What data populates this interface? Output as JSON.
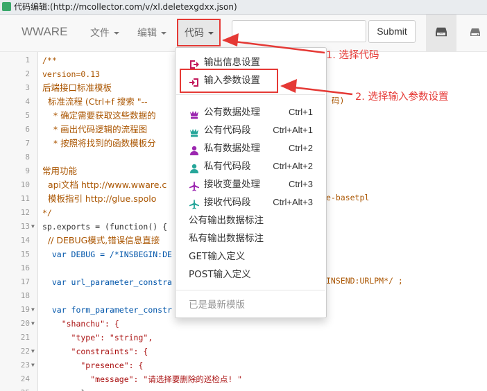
{
  "window": {
    "title": "代码编辑:(http://mcollector.com/v/xl.deletexgdxx.json)"
  },
  "navbar": {
    "brand": "WWARE",
    "menus": [
      {
        "label": "文件"
      },
      {
        "label": "编辑"
      },
      {
        "label": "代码"
      }
    ],
    "search": {
      "value": "",
      "placeholder": ""
    },
    "submit_label": "Submit"
  },
  "dropdown": {
    "items": [
      {
        "label": "输出信息设置",
        "icon": "sign-out-icon",
        "color": "#c2185b",
        "shortcut": ""
      },
      {
        "label": "输入参数设置",
        "icon": "sign-in-icon",
        "color": "#c2185b",
        "shortcut": ""
      },
      {
        "label": "公有数据处理",
        "icon": "chess-queen-icon",
        "color": "#9c27b0",
        "shortcut": "Ctrl+1"
      },
      {
        "label": "公有代码段",
        "icon": "chess-queen-icon",
        "color": "#26a69a",
        "shortcut": "Ctrl+Alt+1"
      },
      {
        "label": "私有数据处理",
        "icon": "user-icon",
        "color": "#9c27b0",
        "shortcut": "Ctrl+2"
      },
      {
        "label": "私有代码段",
        "icon": "user-icon",
        "color": "#26a69a",
        "shortcut": "Ctrl+Alt+2"
      },
      {
        "label": "接收变量处理",
        "icon": "plane-icon",
        "color": "#9c27b0",
        "shortcut": "Ctrl+3"
      },
      {
        "label": "接收代码段",
        "icon": "plane-icon",
        "color": "#26a69a",
        "shortcut": "Ctrl+Alt+3"
      },
      {
        "label": "公有输出数据标注",
        "icon": "",
        "color": "",
        "shortcut": ""
      },
      {
        "label": "私有输出数据标注",
        "icon": "",
        "color": "",
        "shortcut": ""
      },
      {
        "label": "GET输入定义",
        "icon": "",
        "color": "",
        "shortcut": ""
      },
      {
        "label": "POST输入定义",
        "icon": "",
        "color": "",
        "shortcut": ""
      }
    ],
    "latest_label": "已是最新模版"
  },
  "annotations": {
    "step1": "1. 选择代码",
    "step2": "2. 选择输入参数设置",
    "color": "#e53935"
  },
  "editor": {
    "lines": [
      {
        "n": "1",
        "fold": "",
        "text": "/**"
      },
      {
        "n": "2",
        "fold": "",
        "text": "version=0.13"
      },
      {
        "n": "3",
        "fold": "",
        "text": "后端接口标准模板"
      },
      {
        "n": "4",
        "fold": "",
        "text": "  标准流程 (Ctrl+f 搜索 \"--"
      },
      {
        "n": "5",
        "fold": "",
        "text": "    * 确定需要获取这些数据的"
      },
      {
        "n": "6",
        "fold": "",
        "text": "    * 画出代码逻辑的流程图 "
      },
      {
        "n": "7",
        "fold": "",
        "text": "    * 按照将找到的函数模板分"
      },
      {
        "n": "8",
        "fold": "",
        "text": ""
      },
      {
        "n": "9",
        "fold": "",
        "text": "常用功能"
      },
      {
        "n": "10",
        "fold": "",
        "text": "  api文档 http://www.wware.c"
      },
      {
        "n": "11",
        "fold": "",
        "text": "  模板指引 http://glue.spolo"
      },
      {
        "n": "12",
        "fold": "",
        "text": "*/"
      },
      {
        "n": "13",
        "fold": "▼",
        "text": "sp.exports = (function() {"
      },
      {
        "n": "14",
        "fold": "",
        "text": "  // DEBUG模式,错误信息直接"
      },
      {
        "n": "15",
        "fold": "",
        "text": "  var DEBUG = /*INSBEGIN:DE"
      },
      {
        "n": "16",
        "fold": "",
        "text": ""
      },
      {
        "n": "17",
        "fold": "",
        "text": "  var url_parameter_constra"
      },
      {
        "n": "18",
        "fold": "",
        "text": ""
      },
      {
        "n": "19",
        "fold": "▼",
        "text": "  var form_parameter_constr"
      },
      {
        "n": "20",
        "fold": "▼",
        "text": "    \"shanchu\": {"
      },
      {
        "n": "21",
        "fold": "",
        "text": "      \"type\": \"string\","
      },
      {
        "n": "22",
        "fold": "▼",
        "text": "      \"constraints\": {"
      },
      {
        "n": "23",
        "fold": "▼",
        "text": "        \"presence\": {"
      },
      {
        "n": "24",
        "fold": "",
        "text": "          \"message\": \"请选择要删除的巡检点! \""
      },
      {
        "n": "25",
        "fold": "",
        "text": "        }"
      }
    ],
    "right_fragments": {
      "line4": "码)",
      "line11": "e-basetpl",
      "line17": "INSEND:URLPM*/ ;"
    }
  }
}
